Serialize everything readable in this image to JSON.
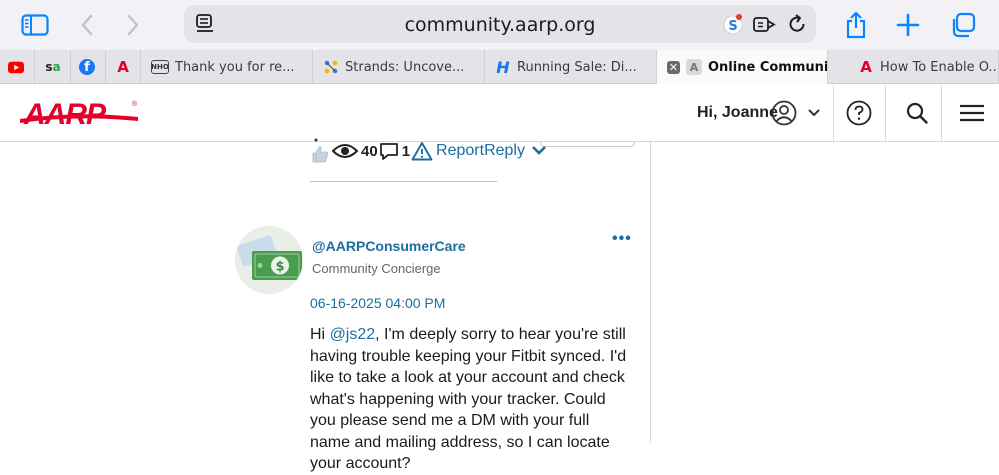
{
  "browser": {
    "url": "community.aarp.org",
    "tabs": [
      {
        "label": "Thank you for re..."
      },
      {
        "label": "Strands: Uncove..."
      },
      {
        "label": "Running Sale: Di..."
      },
      {
        "label": "Online Communi..."
      },
      {
        "label": "How To Enable O..."
      }
    ],
    "pinned_tabs": [
      "youtube",
      "seekingalpha",
      "facebook",
      "aarp"
    ]
  },
  "site_header": {
    "logo": "AARP",
    "greeting": "Hi, Joanne"
  },
  "previous_post": {
    "views": "40",
    "replies": "1",
    "report_label": "Report",
    "reply_label": "Reply"
  },
  "reply_post": {
    "author": "@AARPConsumerCare",
    "role": "Community Concierge",
    "more": "•••",
    "date": "06-16-2025 04:00 PM",
    "greeting_prefix": "Hi ",
    "mention": "@js22",
    "body": ", I'm deeply sorry to hear you're still having trouble keeping your Fitbit synced. I'd like to take a look at your account and check what's happening with your tracker. Could you please send me a DM with your full name and mailing address, so I can locate your account?"
  },
  "colors": {
    "aarp_red": "#e4002b",
    "link_blue": "#1b6e9e",
    "safari_blue": "#0a84ff"
  }
}
